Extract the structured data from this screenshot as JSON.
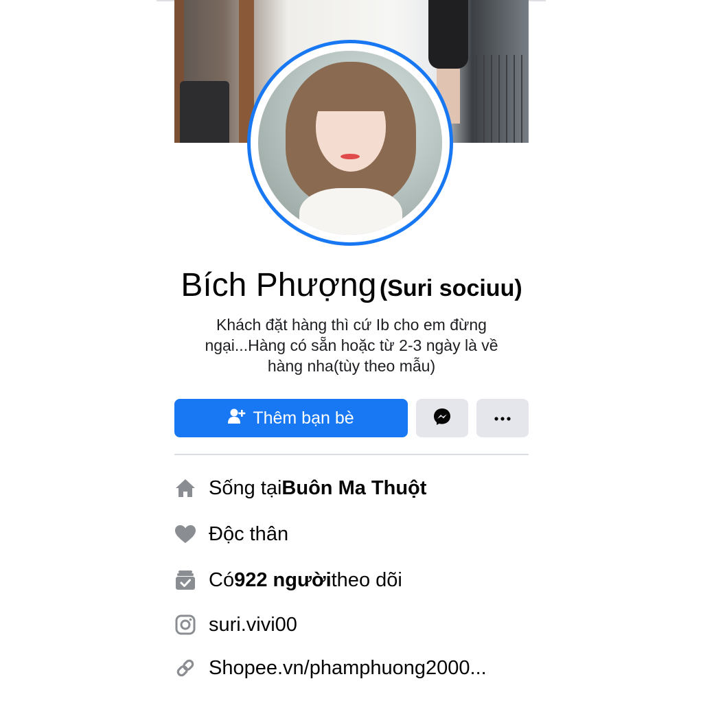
{
  "profile": {
    "name": "Bích Phượng",
    "alternate_name": "(Suri sociuu)",
    "bio": "Khách đặt hàng thì cứ Ib cho em đừng ngại...Hàng có sẵn hoặc từ 2-3 ngày là về hàng nha(tùy theo mẫu)"
  },
  "actions": {
    "add_friend_label": "Thêm bạn bè",
    "add_friend_icon": "add-friend-icon",
    "messenger_icon": "messenger-icon",
    "more_icon": "more-icon"
  },
  "details": {
    "lives_in_prefix": "Sống tại ",
    "lives_in_city": "Buôn Ma Thuột",
    "relationship": "Độc thân",
    "followers_prefix": "Có ",
    "followers_count": "922 người",
    "followers_suffix": " theo dõi",
    "instagram": "suri.vivi00",
    "website": "Shopee.vn/phamphuong2000..."
  },
  "colors": {
    "accent": "#1877f2",
    "button_gray": "#e4e6eb",
    "icon_gray": "#8a8d91"
  }
}
